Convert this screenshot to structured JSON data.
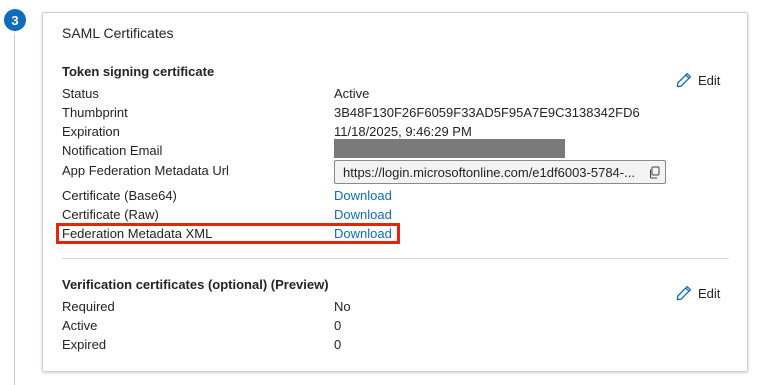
{
  "step": {
    "number": "3"
  },
  "card": {
    "title": "SAML Certificates"
  },
  "token_signing": {
    "heading": "Token signing certificate",
    "edit_label": "Edit",
    "rows": [
      {
        "label": "Status",
        "value": "Active"
      },
      {
        "label": "Thumbprint",
        "value": "3B48F130F26F6059F33AD5F95A7E9C3138342FD6"
      },
      {
        "label": "Expiration",
        "value": "11/18/2025, 9:46:29 PM"
      },
      {
        "label": "Notification Email",
        "value": ""
      },
      {
        "label": "App Federation Metadata Url",
        "value": "https://login.microsoftonline.com/e1df6003-5784-..."
      },
      {
        "label": "Certificate (Base64)",
        "value": "Download"
      },
      {
        "label": "Certificate (Raw)",
        "value": "Download"
      },
      {
        "label": "Federation Metadata XML",
        "value": "Download"
      }
    ]
  },
  "verification": {
    "heading": "Verification certificates (optional) (Preview)",
    "edit_label": "Edit",
    "rows": [
      {
        "label": "Required",
        "value": "No"
      },
      {
        "label": "Active",
        "value": "0"
      },
      {
        "label": "Expired",
        "value": "0"
      }
    ]
  },
  "colors": {
    "accent": "#0f6cbd",
    "highlight": "#e8230b",
    "redaction": "#7a7a7a"
  },
  "icons": {
    "edit": "pencil-icon",
    "copy": "copy-icon"
  }
}
